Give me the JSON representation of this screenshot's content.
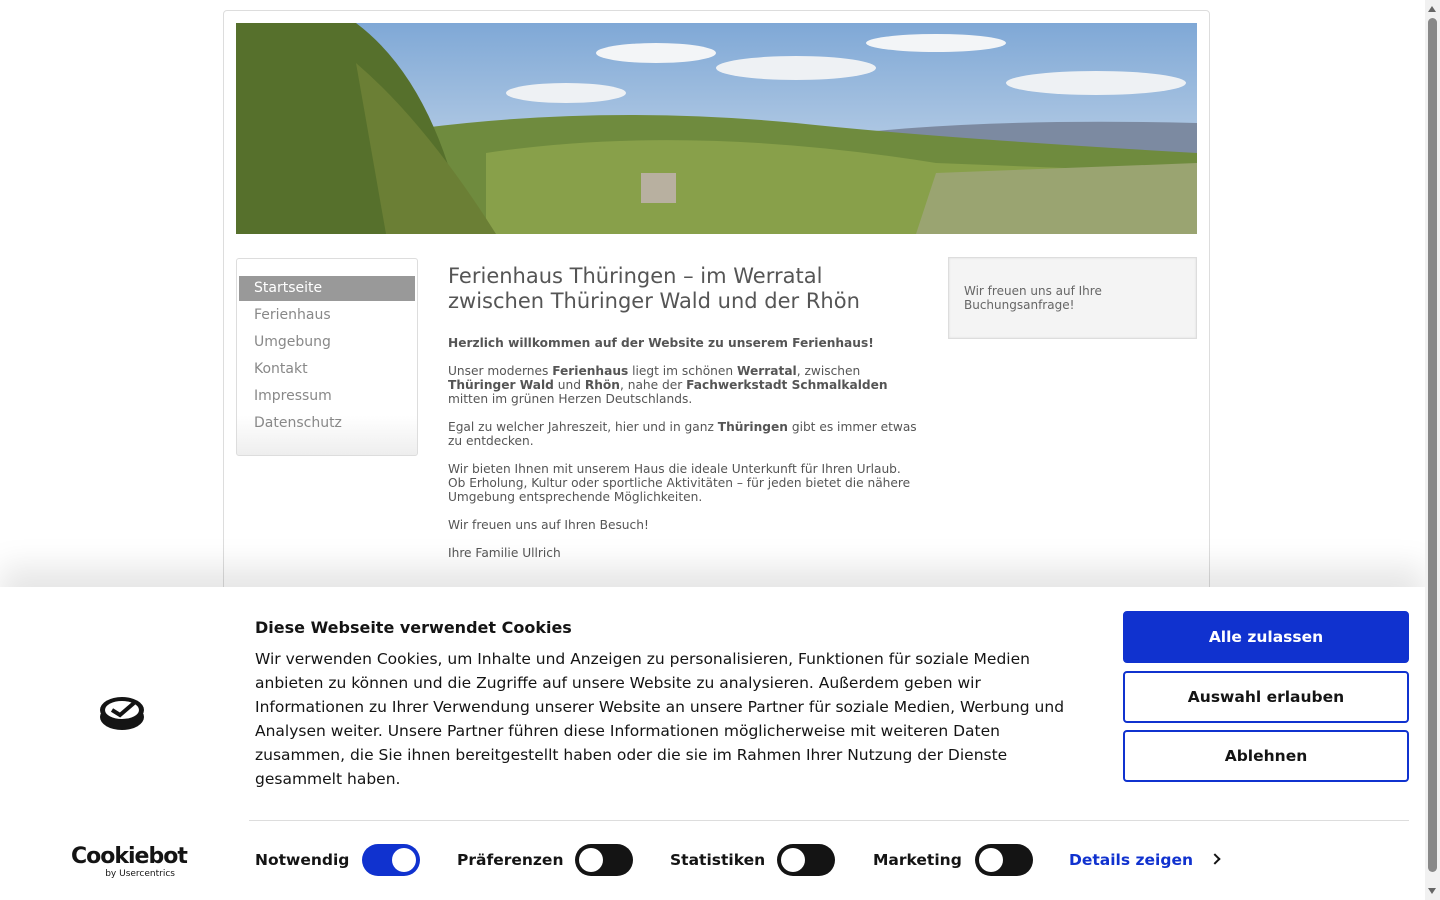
{
  "nav": {
    "items": [
      {
        "label": "Startseite",
        "active": true
      },
      {
        "label": "Ferienhaus"
      },
      {
        "label": "Umgebung"
      },
      {
        "label": "Kontakt"
      },
      {
        "label": "Impressum"
      },
      {
        "label": "Datenschutz"
      }
    ]
  },
  "main": {
    "title": "Ferienhaus Thüringen – im Werratal zwischen Thüringer Wald und der Rhön",
    "welcome": "Herzlich willkommen auf der Website zu unserem Ferienhaus!",
    "p1_a": "Unser modernes ",
    "p1_b": "Ferienhaus",
    "p1_c": " liegt im schönen ",
    "p1_d": "Werratal",
    "p1_e": ", zwischen ",
    "p1_f": "Thüringer Wald",
    "p1_g": " und ",
    "p1_h": "Rhön",
    "p1_i": ", nahe der ",
    "p1_j": "Fachwerkstadt Schmalkalden",
    "p1_k": " mitten im grünen Herzen Deutschlands.",
    "p2_a": "Egal zu welcher Jahreszeit, hier und in ganz ",
    "p2_b": "Thüringen",
    "p2_c": " gibt es immer etwas zu entdecken.",
    "p3": "Wir bieten Ihnen mit unserem Haus die ideale Unterkunft für Ihren Urlaub. Ob Erholung, Kultur oder sportliche Aktivitäten – für jeden bietet die nähere Umgebung entsprechende Möglichkeiten.",
    "p4": "Wir freuen uns auf Ihren Besuch!",
    "p5": "Ihre Familie Ullrich"
  },
  "sidebar_right": {
    "text": "Wir freuen uns auf Ihre Buchungsanfrage!"
  },
  "cookie": {
    "title": "Diese Webseite verwendet Cookies",
    "text": "Wir verwenden Cookies, um Inhalte und Anzeigen zu personalisieren, Funktionen für soziale Medien anbieten zu können und die Zugriffe auf unsere Website zu analysieren. Außerdem geben wir Informationen zu Ihrer Verwendung unserer Website an unsere Partner für soziale Medien, Werbung und Analysen weiter. Unsere Partner führen diese Informationen möglicherweise mit weiteren Daten zusammen, die Sie ihnen bereitgestellt haben oder die sie im Rahmen Ihrer Nutzung der Dienste gesammelt haben.",
    "btn_allow_all": "Alle zulassen",
    "btn_allow_selection": "Auswahl erlauben",
    "btn_deny": "Ablehnen",
    "toggles": [
      {
        "label": "Notwendig",
        "on": true
      },
      {
        "label": "Präferenzen",
        "on": false
      },
      {
        "label": "Statistiken",
        "on": false
      },
      {
        "label": "Marketing",
        "on": false
      }
    ],
    "details": "Details zeigen",
    "brand_name": "Cookiebot",
    "brand_sub": "by Usercentrics",
    "accent": "#1032cf"
  }
}
